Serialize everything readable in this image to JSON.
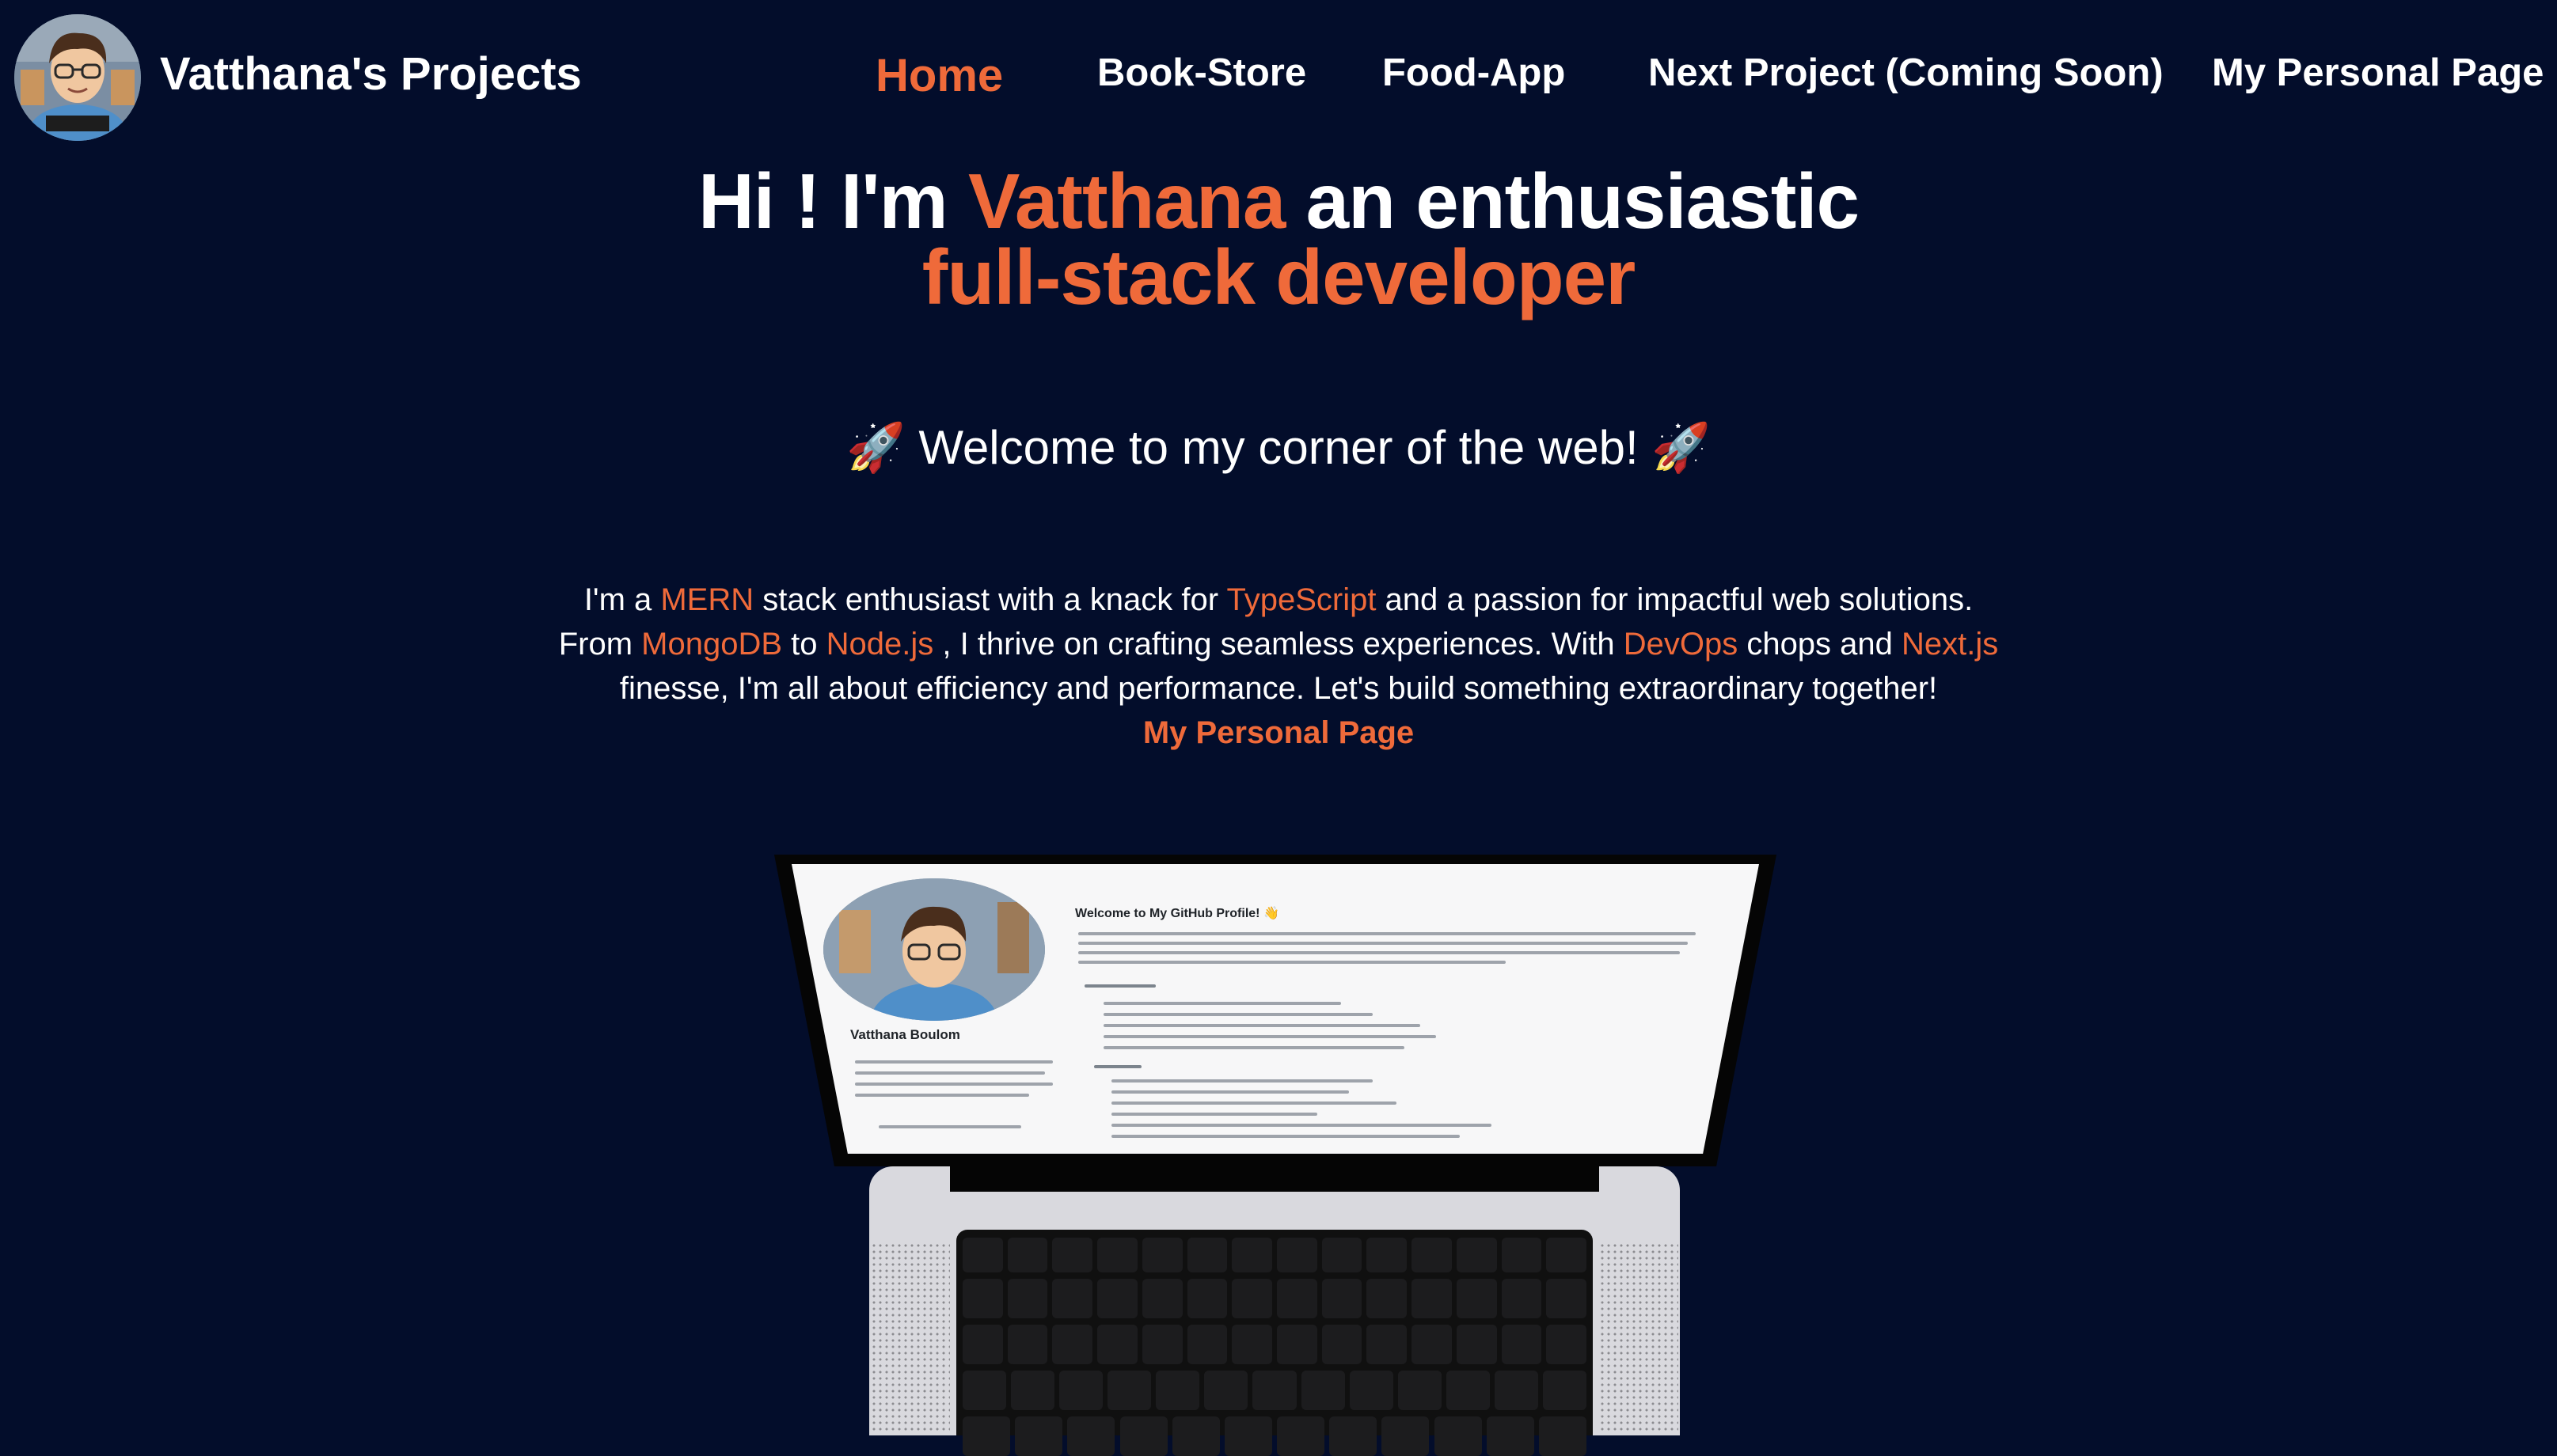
{
  "colors": {
    "background": "#030d2b",
    "accent": "#ef6a3a",
    "text": "#ffffff"
  },
  "header": {
    "avatar_icon": "cartoon-developer-avatar",
    "brand": "Vatthana's Projects",
    "nav": [
      {
        "label": "Home",
        "active": true
      },
      {
        "label": "Book-Store"
      },
      {
        "label": "Food-App"
      },
      {
        "label": "Next Project (Coming Soon)"
      },
      {
        "label": "My Personal Page"
      }
    ]
  },
  "hero": {
    "line1_prefix": "Hi ! I'm ",
    "line1_name": "Vatthana",
    "line1_suffix": " an enthusiastic",
    "line2": "full-stack developer"
  },
  "welcome": {
    "rocket_left": "🚀",
    "text": " Welcome to my corner of the web! ",
    "rocket_right": "🚀"
  },
  "intro": {
    "l1_a": "I'm a ",
    "l1_mern": "MERN",
    "l1_b": " stack enthusiast with a knack for ",
    "l1_ts": "TypeScript",
    "l1_c": " and a passion for impactful web solutions.",
    "l2_a": "From ",
    "l2_mongo": "MongoDB",
    "l2_b": " to ",
    "l2_node": "Node.js",
    "l2_c": " , I thrive on crafting seamless experiences. With ",
    "l2_devops": "DevOps",
    "l2_d": " chops and ",
    "l2_next": "Next.js",
    "l3": "finesse, I'm all about efficiency and performance. Let's build something extraordinary together!",
    "link": "My Personal Page"
  },
  "laptop_screen": {
    "profile_name": "Vatthana Boulom",
    "readme_title": "Welcome to My GitHub Profile! 👋"
  }
}
